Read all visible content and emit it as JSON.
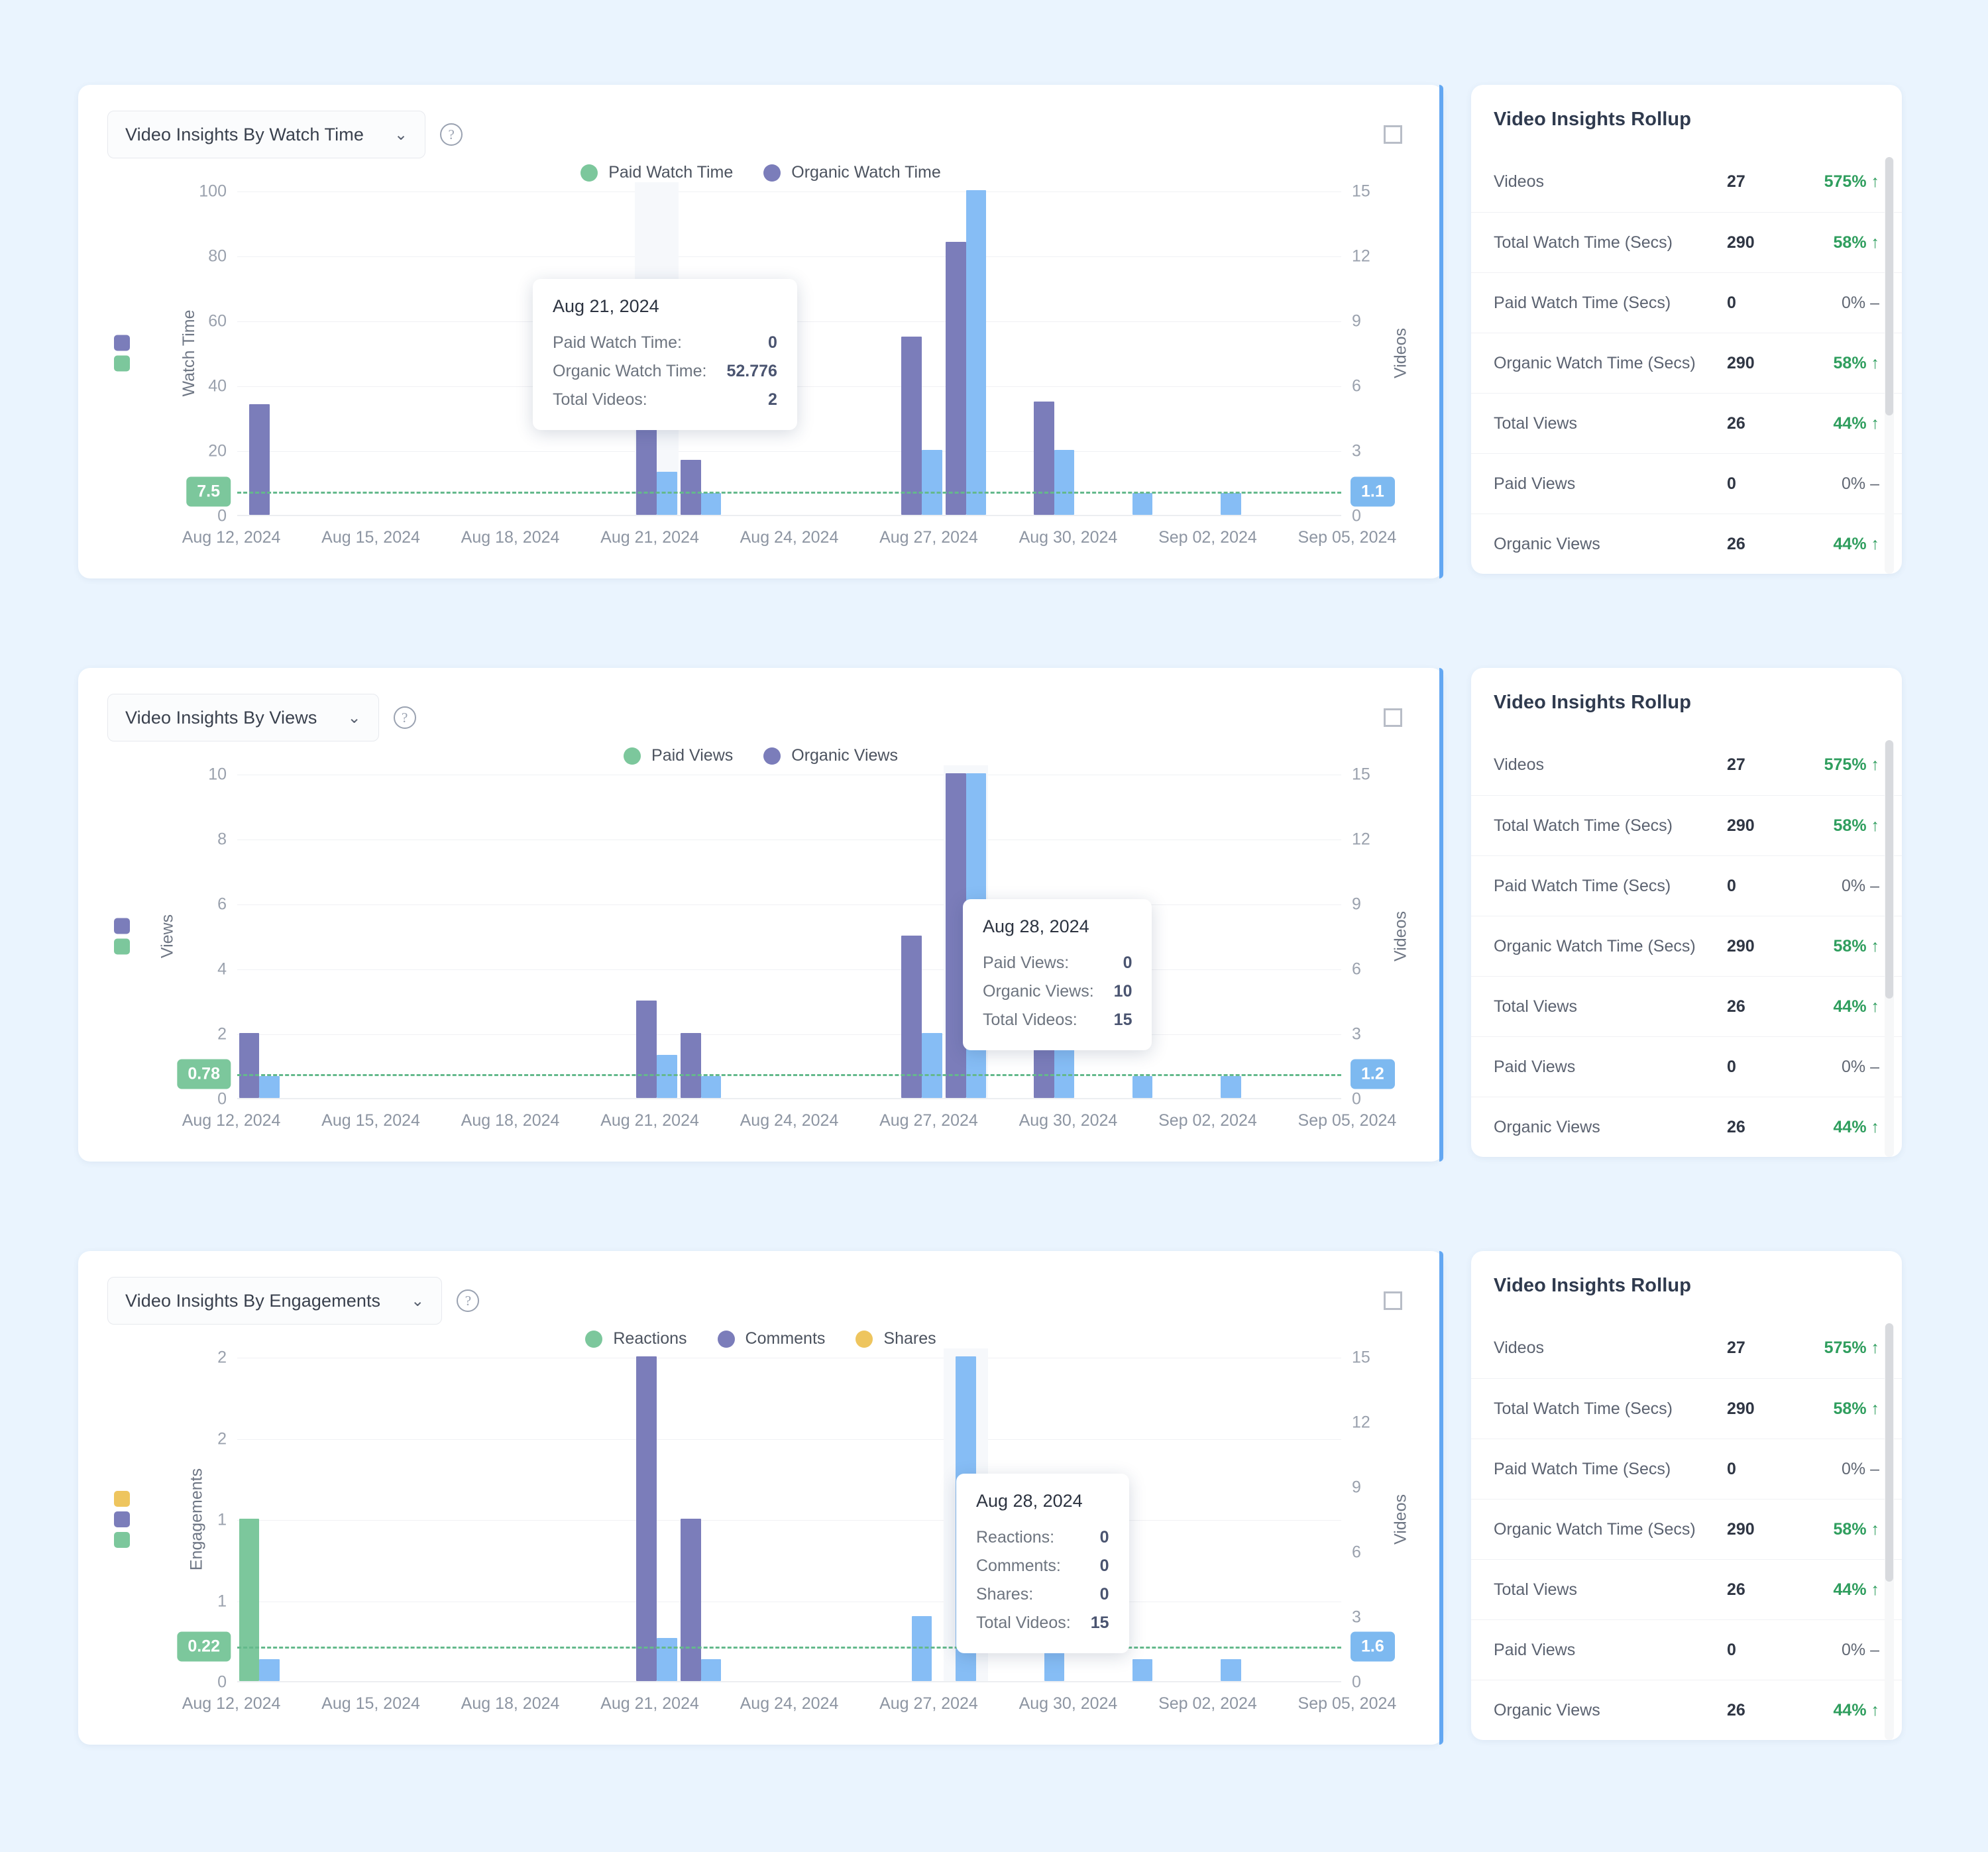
{
  "colors": {
    "paid": "#7cc79c",
    "organic": "#7b7dba",
    "videos": "#86bdf5",
    "shares": "#eec55e",
    "avg_line": "#64b98c",
    "badge_left": "#7cc79c",
    "badge_right": "#7db9f0",
    "accent": "#63a7f2",
    "delta_up": "#2f9e5e",
    "page_bg": "#eaf4fe"
  },
  "rollup": {
    "title": "Video Insights Rollup",
    "rows": [
      {
        "label": "Videos",
        "value": "27",
        "delta": "575% ↑",
        "dir": "up"
      },
      {
        "label": "Total Watch Time (Secs)",
        "value": "290",
        "delta": "58% ↑",
        "dir": "up"
      },
      {
        "label": "Paid Watch Time (Secs)",
        "value": "0",
        "delta": "0% –",
        "dir": "flat"
      },
      {
        "label": "Organic Watch Time (Secs)",
        "value": "290",
        "delta": "58% ↑",
        "dir": "up"
      },
      {
        "label": "Total Views",
        "value": "26",
        "delta": "44% ↑",
        "dir": "up"
      },
      {
        "label": "Paid Views",
        "value": "0",
        "delta": "0% –",
        "dir": "flat"
      },
      {
        "label": "Organic Views",
        "value": "26",
        "delta": "44% ↑",
        "dir": "up"
      }
    ]
  },
  "charts": [
    {
      "selector_label": "Video Insights By Watch Time",
      "chevron": "⌄",
      "help": "?",
      "avg_left_badge": "7.5",
      "avg_right_badge": "1.1",
      "tooltip": {
        "date": "Aug 21, 2024",
        "rows": [
          {
            "label": "Paid Watch Time:",
            "value": "0"
          },
          {
            "label": "Organic Watch Time:",
            "value": "52.776"
          },
          {
            "label": "Total Videos:",
            "value": "2"
          }
        ]
      }
    },
    {
      "selector_label": "Video Insights By Views",
      "chevron": "⌄",
      "help": "?",
      "avg_left_badge": "0.78",
      "avg_right_badge": "1.2",
      "tooltip": {
        "date": "Aug 28, 2024",
        "rows": [
          {
            "label": "Paid Views:",
            "value": "0"
          },
          {
            "label": "Organic Views:",
            "value": "10"
          },
          {
            "label": "Total Videos:",
            "value": "15"
          }
        ]
      }
    },
    {
      "selector_label": "Video Insights By Engagements",
      "chevron": "⌄",
      "help": "?",
      "avg_left_badge": "0.22",
      "avg_right_badge": "1.6",
      "tooltip": {
        "date": "Aug 28, 2024",
        "rows": [
          {
            "label": "Reactions:",
            "value": "0"
          },
          {
            "label": "Comments:",
            "value": "0"
          },
          {
            "label": "Shares:",
            "value": "0"
          },
          {
            "label": "Total Videos:",
            "value": "15"
          }
        ]
      }
    }
  ],
  "chart_data": [
    {
      "type": "bar",
      "title": "Video Insights By Watch Time",
      "xlabel": "",
      "ylabel": "Watch Time",
      "y2label": "Videos",
      "ylim": [
        0,
        100
      ],
      "yticks": [
        0,
        20,
        40,
        60,
        80,
        100
      ],
      "y2lim": [
        0,
        15
      ],
      "y2ticks": [
        0,
        3,
        6,
        9,
        12,
        15
      ],
      "xtick_labels": [
        "Aug 12, 2024",
        "Aug 15, 2024",
        "Aug 18, 2024",
        "Aug 21, 2024",
        "Aug 24, 2024",
        "Aug 27, 2024",
        "Aug 30, 2024",
        "Sep 02, 2024",
        "Sep 05, 2024"
      ],
      "legend": [
        {
          "name": "Paid Watch Time",
          "color": "#7cc79c"
        },
        {
          "name": "Organic Watch Time",
          "color": "#7b7dba"
        }
      ],
      "legend_position": "top-center",
      "grid": true,
      "average_line": {
        "left_value": "7.5",
        "right_value": "1.1",
        "y_frac": 0.075
      },
      "x": [
        "Aug 12",
        "Aug 13",
        "Aug 14",
        "Aug 15",
        "Aug 16",
        "Aug 17",
        "Aug 18",
        "Aug 19",
        "Aug 20",
        "Aug 21",
        "Aug 22",
        "Aug 23",
        "Aug 24",
        "Aug 25",
        "Aug 26",
        "Aug 27",
        "Aug 28",
        "Aug 29",
        "Aug 30",
        "Aug 31",
        "Sep 01",
        "Sep 02",
        "Sep 03",
        "Sep 04",
        "Sep 05"
      ],
      "series": [
        {
          "name": "Paid Watch Time",
          "color": "#7cc79c",
          "axis": "left",
          "values": [
            0,
            0,
            0,
            0,
            0,
            0,
            0,
            0,
            0,
            0,
            0,
            0,
            0,
            0,
            0,
            0,
            0,
            0,
            0,
            0,
            0,
            0,
            0,
            0,
            0
          ]
        },
        {
          "name": "Organic Watch Time",
          "color": "#7b7dba",
          "axis": "left",
          "values": [
            34,
            0,
            0,
            0,
            0,
            0,
            0,
            0,
            0,
            52.776,
            17,
            0,
            0,
            0,
            0,
            55,
            84,
            0,
            35,
            0,
            0,
            0,
            0,
            0,
            0
          ]
        },
        {
          "name": "Videos",
          "color": "#86bdf5",
          "axis": "right",
          "values": [
            0,
            0,
            0,
            0,
            0,
            0,
            0,
            0,
            0,
            2,
            1,
            0,
            0,
            0,
            0,
            3,
            15,
            0,
            3,
            0,
            1,
            0,
            1,
            0,
            0
          ]
        }
      ]
    },
    {
      "type": "bar",
      "title": "Video Insights By Views",
      "xlabel": "",
      "ylabel": "Views",
      "y2label": "Videos",
      "ylim": [
        0,
        10
      ],
      "yticks": [
        0,
        2,
        4,
        6,
        8,
        10
      ],
      "y2lim": [
        0,
        15
      ],
      "y2ticks": [
        0,
        3,
        6,
        9,
        12,
        15
      ],
      "xtick_labels": [
        "Aug 12, 2024",
        "Aug 15, 2024",
        "Aug 18, 2024",
        "Aug 21, 2024",
        "Aug 24, 2024",
        "Aug 27, 2024",
        "Aug 30, 2024",
        "Sep 02, 2024",
        "Sep 05, 2024"
      ],
      "legend": [
        {
          "name": "Paid Views",
          "color": "#7cc79c"
        },
        {
          "name": "Organic Views",
          "color": "#7b7dba"
        }
      ],
      "legend_position": "top-center",
      "grid": true,
      "average_line": {
        "left_value": "0.78",
        "right_value": "1.2",
        "y_frac": 0.078
      },
      "x": [
        "Aug 12",
        "Aug 13",
        "Aug 14",
        "Aug 15",
        "Aug 16",
        "Aug 17",
        "Aug 18",
        "Aug 19",
        "Aug 20",
        "Aug 21",
        "Aug 22",
        "Aug 23",
        "Aug 24",
        "Aug 25",
        "Aug 26",
        "Aug 27",
        "Aug 28",
        "Aug 29",
        "Aug 30",
        "Aug 31",
        "Sep 01",
        "Sep 02",
        "Sep 03",
        "Sep 04",
        "Sep 05"
      ],
      "series": [
        {
          "name": "Paid Views",
          "color": "#7cc79c",
          "axis": "left",
          "values": [
            0,
            0,
            0,
            0,
            0,
            0,
            0,
            0,
            0,
            0,
            0,
            0,
            0,
            0,
            0,
            0,
            0,
            0,
            0,
            0,
            0,
            0,
            0,
            0,
            0
          ]
        },
        {
          "name": "Organic Views",
          "color": "#7b7dba",
          "axis": "left",
          "values": [
            2,
            0,
            0,
            0,
            0,
            0,
            0,
            0,
            0,
            3,
            2,
            0,
            0,
            0,
            0,
            5,
            10,
            0,
            1.6,
            0,
            0,
            0,
            0,
            0,
            0
          ]
        },
        {
          "name": "Videos",
          "color": "#86bdf5",
          "axis": "right",
          "values": [
            1,
            0,
            0,
            0,
            0,
            0,
            0,
            0,
            0,
            2,
            1,
            0,
            0,
            0,
            0,
            3,
            15,
            0,
            3,
            0,
            1,
            0,
            1,
            0,
            0
          ]
        }
      ]
    },
    {
      "type": "bar",
      "title": "Video Insights By Engagements",
      "xlabel": "",
      "ylabel": "Engagements",
      "y2label": "Videos",
      "ylim": [
        0,
        2
      ],
      "yticks": [
        0,
        1,
        1,
        2,
        2
      ],
      "ytick_labels": [
        "0",
        "1",
        "1",
        "2",
        "2"
      ],
      "y2lim": [
        0,
        15
      ],
      "y2ticks": [
        0,
        3,
        6,
        9,
        12,
        15
      ],
      "xtick_labels": [
        "Aug 12, 2024",
        "Aug 15, 2024",
        "Aug 18, 2024",
        "Aug 21, 2024",
        "Aug 24, 2024",
        "Aug 27, 2024",
        "Aug 30, 2024",
        "Sep 02, 2024",
        "Sep 05, 2024"
      ],
      "legend": [
        {
          "name": "Reactions",
          "color": "#7cc79c"
        },
        {
          "name": "Comments",
          "color": "#7b7dba"
        },
        {
          "name": "Shares",
          "color": "#eec55e"
        }
      ],
      "legend_position": "top-center",
      "grid": true,
      "average_line": {
        "left_value": "0.22",
        "right_value": "1.6",
        "y_frac": 0.11
      },
      "x": [
        "Aug 12",
        "Aug 13",
        "Aug 14",
        "Aug 15",
        "Aug 16",
        "Aug 17",
        "Aug 18",
        "Aug 19",
        "Aug 20",
        "Aug 21",
        "Aug 22",
        "Aug 23",
        "Aug 24",
        "Aug 25",
        "Aug 26",
        "Aug 27",
        "Aug 28",
        "Aug 29",
        "Aug 30",
        "Aug 31",
        "Sep 01",
        "Sep 02",
        "Sep 03",
        "Sep 04",
        "Sep 05"
      ],
      "series": [
        {
          "name": "Reactions",
          "color": "#7cc79c",
          "axis": "left",
          "values": [
            1,
            0,
            0,
            0,
            0,
            0,
            0,
            0,
            0,
            0,
            0,
            0,
            0,
            0,
            0,
            0,
            0,
            0,
            0,
            0,
            0,
            0,
            0,
            0,
            0
          ]
        },
        {
          "name": "Comments",
          "color": "#7b7dba",
          "axis": "left",
          "values": [
            0,
            0,
            0,
            0,
            0,
            0,
            0,
            0,
            0,
            2,
            1,
            0,
            0,
            0,
            0,
            0,
            0,
            0,
            0,
            0,
            0,
            0,
            0,
            0,
            0
          ]
        },
        {
          "name": "Shares",
          "color": "#eec55e",
          "axis": "left",
          "values": [
            0,
            0,
            0,
            0,
            0,
            0,
            0,
            0,
            0,
            0,
            0,
            0,
            0,
            0,
            0,
            0,
            0,
            0,
            0,
            0,
            0,
            0,
            0,
            0,
            0
          ]
        },
        {
          "name": "Videos",
          "color": "#86bdf5",
          "axis": "right",
          "values": [
            1,
            0,
            0,
            0,
            0,
            0,
            0,
            0,
            0,
            2,
            1,
            0,
            0,
            0,
            0,
            3,
            15,
            0,
            3,
            0,
            1,
            0,
            1,
            0,
            0
          ]
        }
      ]
    }
  ]
}
